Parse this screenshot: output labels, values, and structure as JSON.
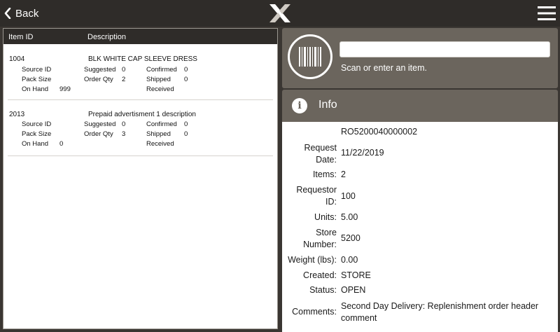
{
  "header": {
    "back_label": "Back"
  },
  "list": {
    "columns": {
      "item_id": "Item ID",
      "description": "Description"
    },
    "field_labels": {
      "source_id": "Source ID",
      "pack_size": "Pack Size",
      "on_hand": "On Hand",
      "suggested": "Suggested",
      "order_qty": "Order Qty",
      "confirmed": "Confirmed",
      "shipped": "Shipped",
      "received": "Received"
    },
    "items": [
      {
        "id": "1004",
        "description": "BLK WHITE CAP SLEEVE DRESS",
        "source_id": "",
        "pack_size": "",
        "on_hand": "999",
        "suggested": "0",
        "order_qty": "2",
        "confirmed": "0",
        "shipped": "0",
        "received": ""
      },
      {
        "id": "2013",
        "description": "Prepaid advertisment 1 description",
        "source_id": "",
        "pack_size": "",
        "on_hand": "0",
        "suggested": "0",
        "order_qty": "3",
        "confirmed": "0",
        "shipped": "0",
        "received": ""
      }
    ]
  },
  "scan": {
    "value": "",
    "hint": "Scan or enter an item."
  },
  "info": {
    "title": "Info",
    "id_value": "RO5200040000002",
    "labels": {
      "request_date_1": "Request",
      "request_date_2": "Date:",
      "items": "Items:",
      "requestor_1": "Requestor",
      "requestor_2": "ID:",
      "units": "Units:",
      "store_1": "Store",
      "store_2": "Number:",
      "weight": "Weight (lbs):",
      "created": "Created:",
      "status": "Status:",
      "comments": "Comments:"
    },
    "values": {
      "request_date": "11/22/2019",
      "items": "2",
      "requestor": "100",
      "units": "5.00",
      "store": "5200",
      "weight": "0.00",
      "created": "STORE",
      "status": "OPEN",
      "comments_1": "Second Day Delivery: Replenishment order header",
      "comments_2": "comment"
    }
  }
}
